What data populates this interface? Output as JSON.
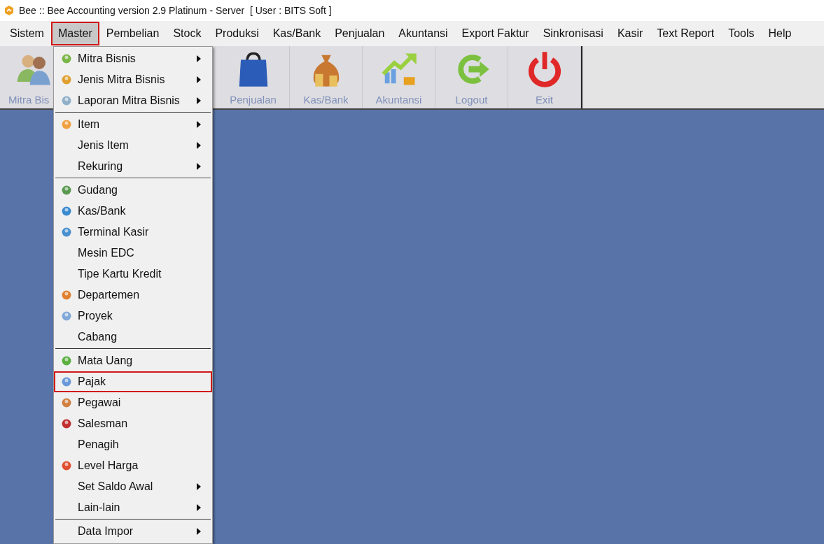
{
  "window": {
    "title": "Bee :: Bee Accounting version 2.9 Platinum - Server  [ User : BITS Soft ]"
  },
  "menubar": [
    {
      "label": "Sistem",
      "selected": false
    },
    {
      "label": "Master",
      "selected": true
    },
    {
      "label": "Pembelian",
      "selected": false
    },
    {
      "label": "Stock",
      "selected": false
    },
    {
      "label": "Produksi",
      "selected": false
    },
    {
      "label": "Kas/Bank",
      "selected": false
    },
    {
      "label": "Penjualan",
      "selected": false
    },
    {
      "label": "Akuntansi",
      "selected": false
    },
    {
      "label": "Export Faktur",
      "selected": false
    },
    {
      "label": "Sinkronisasi",
      "selected": false
    },
    {
      "label": "Kasir",
      "selected": false
    },
    {
      "label": "Text Report",
      "selected": false
    },
    {
      "label": "Tools",
      "selected": false
    },
    {
      "label": "Help",
      "selected": false
    }
  ],
  "toolbar": [
    {
      "label": "Mitra Bis"
    },
    {
      "label": "Penjualan"
    },
    {
      "label": "Kas/Bank"
    },
    {
      "label": "Akuntansi"
    },
    {
      "label": "Logout"
    },
    {
      "label": "Exit"
    }
  ],
  "master_menu": {
    "groups": [
      {
        "items": [
          {
            "label": "Mitra Bisnis",
            "icon": true,
            "submenu": true,
            "selected": false
          },
          {
            "label": "Jenis Mitra Bisnis",
            "icon": true,
            "submenu": true,
            "selected": false
          },
          {
            "label": "Laporan Mitra Bisnis",
            "icon": true,
            "submenu": true,
            "selected": false
          }
        ]
      },
      {
        "items": [
          {
            "label": "Item",
            "icon": true,
            "submenu": true,
            "selected": false
          },
          {
            "label": "Jenis Item",
            "icon": false,
            "submenu": true,
            "selected": false
          },
          {
            "label": "Rekuring",
            "icon": false,
            "submenu": true,
            "selected": false
          }
        ]
      },
      {
        "items": [
          {
            "label": "Gudang",
            "icon": true,
            "submenu": false,
            "selected": false
          },
          {
            "label": "Kas/Bank",
            "icon": true,
            "submenu": false,
            "selected": false
          },
          {
            "label": "Terminal Kasir",
            "icon": true,
            "submenu": false,
            "selected": false
          },
          {
            "label": "Mesin EDC",
            "icon": false,
            "submenu": false,
            "selected": false
          },
          {
            "label": "Tipe Kartu Kredit",
            "icon": false,
            "submenu": false,
            "selected": false
          },
          {
            "label": "Departemen",
            "icon": true,
            "submenu": false,
            "selected": false
          },
          {
            "label": "Proyek",
            "icon": true,
            "submenu": false,
            "selected": false
          },
          {
            "label": "Cabang",
            "icon": false,
            "submenu": false,
            "selected": false
          }
        ]
      },
      {
        "items": [
          {
            "label": "Mata Uang",
            "icon": true,
            "submenu": false,
            "selected": false
          },
          {
            "label": "Pajak",
            "icon": true,
            "submenu": false,
            "selected": true
          },
          {
            "label": "Pegawai",
            "icon": true,
            "submenu": false,
            "selected": false
          },
          {
            "label": "Salesman",
            "icon": true,
            "submenu": false,
            "selected": false
          },
          {
            "label": "Penagih",
            "icon": false,
            "submenu": false,
            "selected": false
          },
          {
            "label": "Level Harga",
            "icon": true,
            "submenu": false,
            "selected": false
          },
          {
            "label": "Set Saldo Awal",
            "icon": false,
            "submenu": true,
            "selected": false
          },
          {
            "label": "Lain-lain",
            "icon": false,
            "submenu": true,
            "selected": false
          }
        ]
      },
      {
        "items": [
          {
            "label": "Data Impor",
            "icon": false,
            "submenu": true,
            "selected": false
          }
        ]
      }
    ]
  }
}
